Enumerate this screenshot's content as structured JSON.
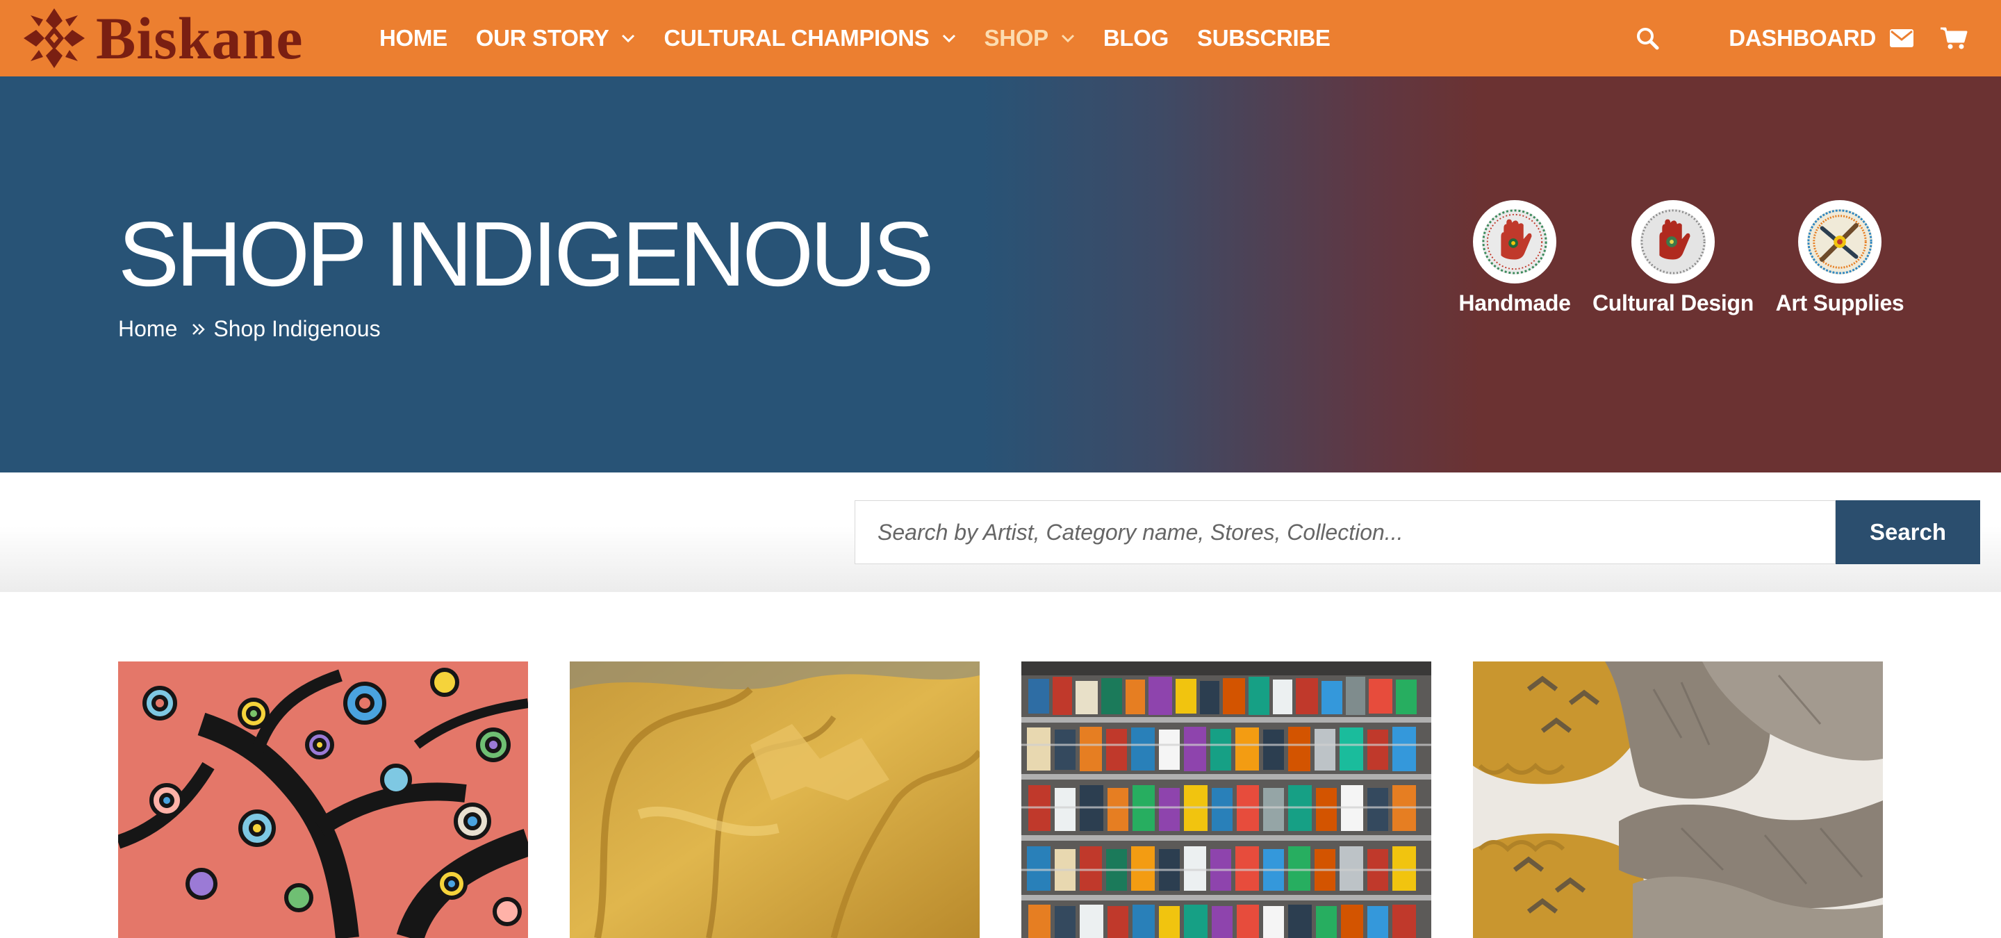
{
  "nav": {
    "logo_text": "Biskane",
    "items": [
      {
        "label": "HOME",
        "dropdown": false,
        "active": false
      },
      {
        "label": "OUR STORY",
        "dropdown": true,
        "active": false
      },
      {
        "label": "CULTURAL CHAMPIONS",
        "dropdown": true,
        "active": false
      },
      {
        "label": "SHOP",
        "dropdown": true,
        "active": true
      },
      {
        "label": "BLOG",
        "dropdown": false,
        "active": false
      },
      {
        "label": "SUBSCRIBE",
        "dropdown": false,
        "active": false
      }
    ],
    "dashboard_label": "DASHBOARD",
    "icons": [
      "search-icon",
      "mail-icon",
      "cart-icon"
    ]
  },
  "hero": {
    "title": "SHOP INDIGENOUS",
    "breadcrumb": [
      "Home",
      "Shop Indigenous"
    ],
    "categories": [
      {
        "label": "Handmade",
        "icon": "beaded-hand-icon"
      },
      {
        "label": "Cultural Design",
        "icon": "beaded-hand-icon"
      },
      {
        "label": "Art Supplies",
        "icon": "beaded-brush-icon"
      }
    ]
  },
  "search": {
    "placeholder": "Search by Artist, Category name, Stores, Collection...",
    "value": "",
    "button_label": "Search"
  },
  "colors": {
    "nav_bg": "#ec7f30",
    "logo": "#7a1f12",
    "hero_blue": "#285376",
    "hero_red": "#6b3232",
    "search_button": "#2b4e6e",
    "active_nav": "#fcdcb0"
  },
  "products": [
    {
      "image": "tree-painting-image"
    },
    {
      "image": "leather-hides-image"
    },
    {
      "image": "bookshelf-image"
    },
    {
      "image": "fur-mittens-image"
    }
  ]
}
